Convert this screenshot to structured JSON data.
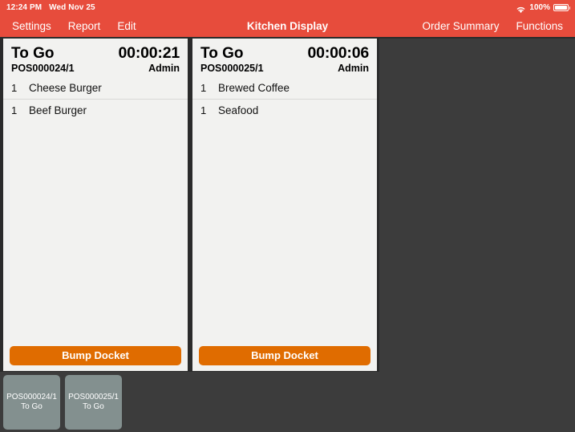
{
  "status_bar": {
    "time": "12:24 PM",
    "date": "Wed Nov 25",
    "wifi_icon": "wifi-icon",
    "battery_percent": "100%",
    "battery_icon": "battery-full-icon"
  },
  "nav": {
    "title": "Kitchen Display",
    "left_items": [
      {
        "label": "Settings",
        "name": "nav-settings"
      },
      {
        "label": "Report",
        "name": "nav-report"
      },
      {
        "label": "Edit",
        "name": "nav-edit"
      }
    ],
    "right_items": [
      {
        "label": "Order Summary",
        "name": "nav-order-summary"
      },
      {
        "label": "Functions",
        "name": "nav-functions"
      }
    ]
  },
  "dockets": [
    {
      "order_type": "To Go",
      "timer": "00:00:21",
      "reference": "POS000024/1",
      "user": "Admin",
      "bump_label": "Bump Docket",
      "items": [
        {
          "qty": "1",
          "name": "Cheese Burger"
        },
        {
          "qty": "1",
          "name": "Beef Burger"
        }
      ]
    },
    {
      "order_type": "To Go",
      "timer": "00:00:06",
      "reference": "POS000025/1",
      "user": "Admin",
      "bump_label": "Bump Docket",
      "items": [
        {
          "qty": "1",
          "name": "Brewed Coffee"
        },
        {
          "qty": "1",
          "name": "Seafood"
        }
      ]
    }
  ],
  "tray": [
    {
      "reference": "POS000024/1",
      "order_type": "To Go"
    },
    {
      "reference": "POS000025/1",
      "order_type": "To Go"
    }
  ],
  "colors": {
    "nav_red": "#e74c3c",
    "background_dark": "#3c3c3c",
    "docket_bg": "#f2f2f0",
    "bump_orange": "#e06c00",
    "thumb_gray": "#83908f"
  }
}
